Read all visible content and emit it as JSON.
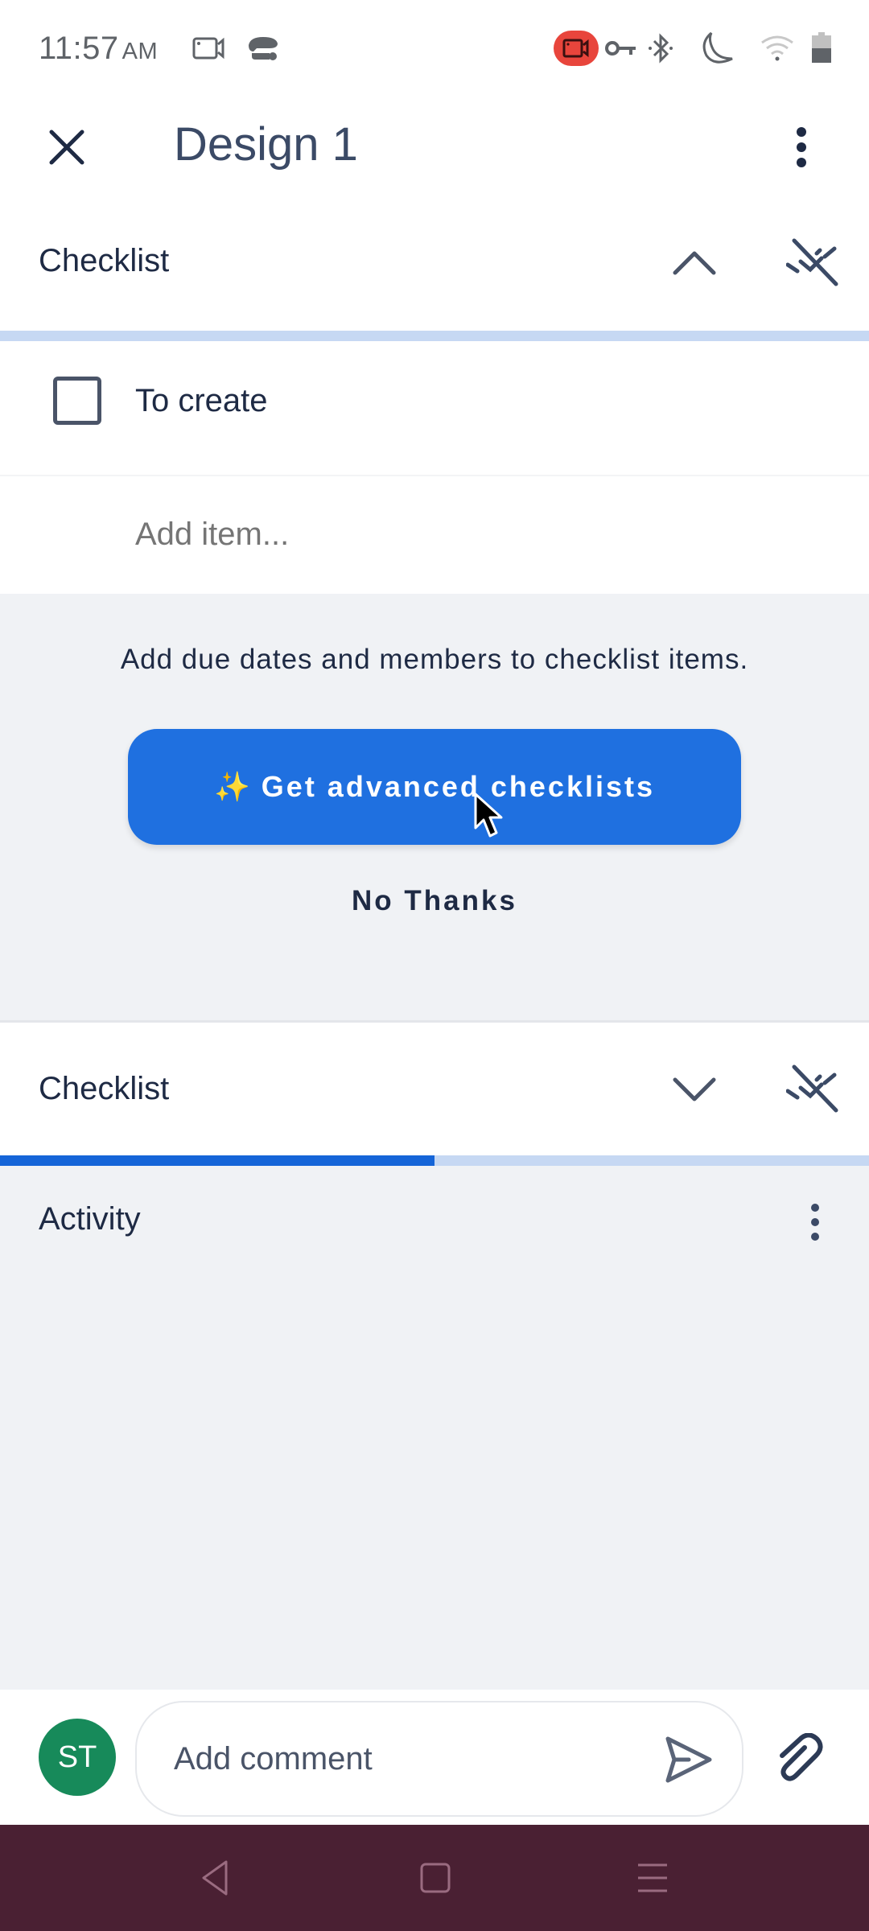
{
  "status_bar": {
    "time": "11:57",
    "ampm": "AM",
    "icons": [
      "screen-record-icon",
      "game-controller-icon",
      "recording-active-icon",
      "vpn-key-icon",
      "bluetooth-icon",
      "do-not-disturb-moon-icon",
      "wifi-icon",
      "battery-icon"
    ]
  },
  "header": {
    "title": "Design 1",
    "close_icon": "close-icon",
    "more_icon": "more-vertical-icon"
  },
  "checklists": [
    {
      "title": "Checklist",
      "expanded": true,
      "progress": 0,
      "items": [
        {
          "label": "To create",
          "checked": false
        }
      ],
      "add_item_placeholder": "Add item..."
    },
    {
      "title": "Checklist",
      "expanded": false,
      "progress": 0.5
    }
  ],
  "upsell": {
    "message": "Add due dates and members to checklist items.",
    "cta_icon": "✨",
    "cta_label": "Get advanced checklists",
    "dismiss_label": "No Thanks"
  },
  "activity": {
    "title": "Activity"
  },
  "comment": {
    "avatar_initials": "ST",
    "placeholder": "Add comment"
  },
  "colors": {
    "primary": "#1f70e0",
    "progress_fill": "#1565d8",
    "progress_track": "#c6d8f3",
    "avatar": "#178a5a",
    "nav_bar": "#4a2033",
    "recording": "#e8453c"
  }
}
